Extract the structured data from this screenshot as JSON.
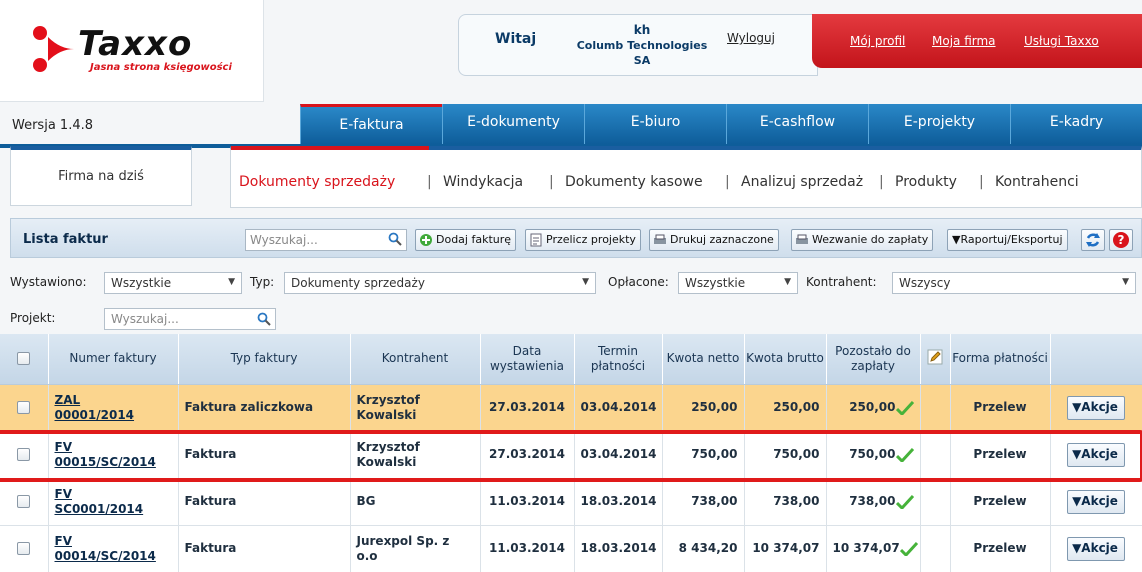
{
  "brand": {
    "name": "Taxxo",
    "tagline": "Jasna strona księgowości",
    "version": "Wersja 1.4.8"
  },
  "user": {
    "greeting": "Witaj",
    "login": "kh",
    "company": "Columb Technologies SA",
    "logout": "Wyloguj"
  },
  "top_links": [
    "Mój profil",
    "Moja firma",
    "Usługi Taxxo"
  ],
  "modules": [
    "E-faktura",
    "E-dokumenty",
    "E-biuro",
    "E-cashflow",
    "E-projekty",
    "E-kadry"
  ],
  "today_button": "Firma na dziś",
  "subnav": [
    "Dokumenty sprzedaży",
    "Windykacja",
    "Dokumenty kasowe",
    "Analizuj sprzedaż",
    "Produkty",
    "Kontrahenci"
  ],
  "list": {
    "title": "Lista faktur",
    "search_placeholder": "Wyszukaj...",
    "buttons": [
      "Dodaj fakturę",
      "Przelicz projekty",
      "Drukuj zaznaczone",
      "Wezwanie do zapłaty",
      "Raportuj/Eksportuj"
    ]
  },
  "filters": {
    "wystawiono_label": "Wystawiono:",
    "wystawiono_value": "Wszystkie",
    "typ_label": "Typ:",
    "typ_value": "Dokumenty sprzedaży",
    "oplacone_label": "Opłacone:",
    "oplacone_value": "Wszystkie",
    "kontrahent_label": "Kontrahent:",
    "kontrahent_value": "Wszyscy",
    "projekt_label": "Projekt:",
    "projekt_placeholder": "Wyszukaj..."
  },
  "columns": [
    "Numer faktury",
    "Typ faktury",
    "Kontrahent",
    "Data wystawienia",
    "Termin płatności",
    "Kwota netto",
    "Kwota brutto",
    "Pozostało do zapłaty",
    "Forma płatności"
  ],
  "rows": [
    {
      "num1": "ZAL",
      "num2": "00001/2014",
      "type": "Faktura zaliczkowa",
      "client1": "Krzysztof",
      "client2": "Kowalski",
      "date": "27.03.2014",
      "due": "03.04.2014",
      "net": "250,00",
      "gross": "250,00",
      "left": "250,00",
      "form": "Przelew",
      "action": "Akcje",
      "highlight": true
    },
    {
      "num1": "FV",
      "num2": "00015/SC/2014",
      "type": "Faktura",
      "client1": "Krzysztof",
      "client2": "Kowalski",
      "date": "27.03.2014",
      "due": "03.04.2014",
      "net": "750,00",
      "gross": "750,00",
      "left": "750,00",
      "form": "Przelew",
      "action": "Akcje",
      "highlight": false
    },
    {
      "num1": "FV",
      "num2": "SC0001/2014",
      "type": "Faktura",
      "client1": "BG",
      "client2": "",
      "date": "11.03.2014",
      "due": "18.03.2014",
      "net": "738,00",
      "gross": "738,00",
      "left": "738,00",
      "form": "Przelew",
      "action": "Akcje",
      "highlight": false
    },
    {
      "num1": "FV",
      "num2": "00014/SC/2014",
      "type": "Faktura",
      "client1": "Jurexpol Sp. z",
      "client2": "o.o",
      "date": "11.03.2014",
      "due": "18.03.2014",
      "net": "8 434,20",
      "gross": "10 374,07",
      "left": "10 374,07",
      "form": "Przelew",
      "action": "Akcje",
      "highlight": false
    }
  ]
}
